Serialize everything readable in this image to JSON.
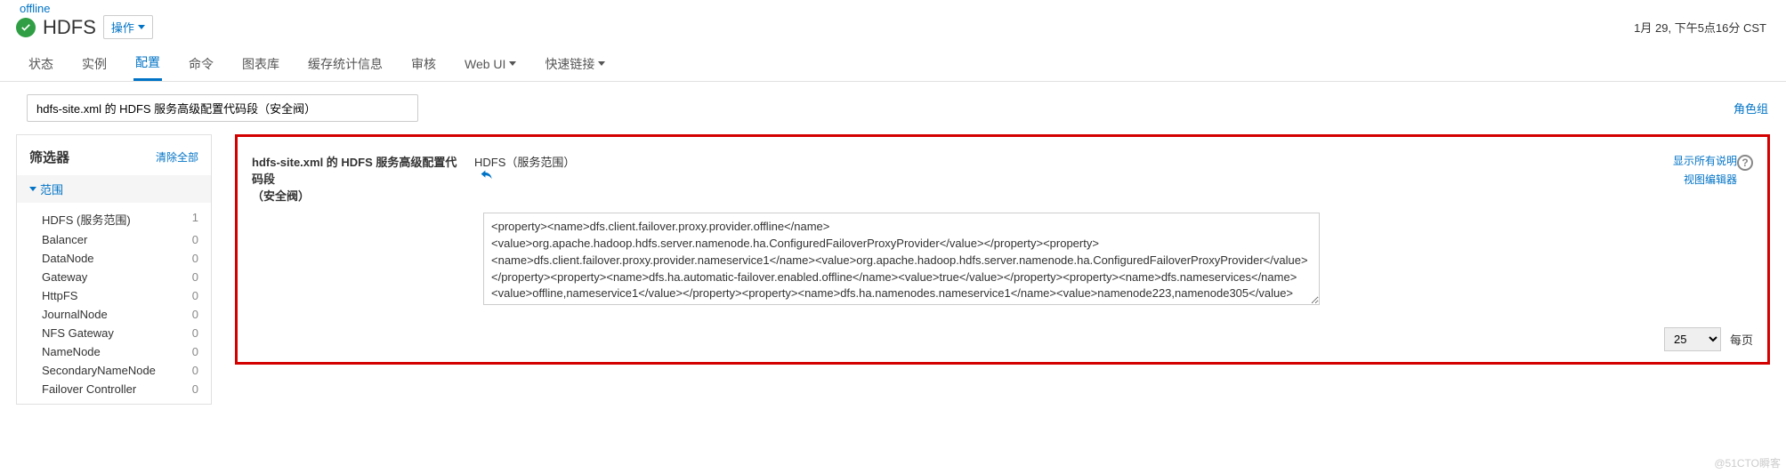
{
  "breadcrumb": {
    "cluster": "offline"
  },
  "header": {
    "title": "HDFS",
    "ops_label": "操作",
    "timestamp": "1月 29, 下午5点16分 CST"
  },
  "tabs": {
    "items": [
      {
        "label": "状态"
      },
      {
        "label": "实例"
      },
      {
        "label": "配置"
      },
      {
        "label": "命令"
      },
      {
        "label": "图表库"
      },
      {
        "label": "缓存统计信息"
      },
      {
        "label": "审核"
      },
      {
        "label": "Web UI"
      },
      {
        "label": "快速链接"
      }
    ]
  },
  "search": {
    "value": "hdfs-site.xml 的 HDFS 服务高级配置代码段（安全阀）",
    "role_group_link": "角色组"
  },
  "filter": {
    "title": "筛选器",
    "clear_all": "清除全部",
    "section_scope": "范围",
    "items": [
      {
        "name": "HDFS (服务范围)",
        "count": "1"
      },
      {
        "name": "Balancer",
        "count": "0"
      },
      {
        "name": "DataNode",
        "count": "0"
      },
      {
        "name": "Gateway",
        "count": "0"
      },
      {
        "name": "HttpFS",
        "count": "0"
      },
      {
        "name": "JournalNode",
        "count": "0"
      },
      {
        "name": "NFS Gateway",
        "count": "0"
      },
      {
        "name": "NameNode",
        "count": "0"
      },
      {
        "name": "SecondaryNameNode",
        "count": "0"
      },
      {
        "name": "Failover Controller",
        "count": "0"
      }
    ]
  },
  "config": {
    "label_line1": "hdfs-site.xml 的 HDFS 服务高级配置代码段",
    "label_line2": "（安全阀）",
    "scope_label": "HDFS（服务范围）",
    "show_desc_link": "显示所有说明",
    "view_editor_link": "视图编辑器",
    "xml_value": "<property><name>dfs.client.failover.proxy.provider.offline</name><value>org.apache.hadoop.hdfs.server.namenode.ha.ConfiguredFailoverProxyProvider</value></property><property><name>dfs.client.failover.proxy.provider.nameservice1</name><value>org.apache.hadoop.hdfs.server.namenode.ha.ConfiguredFailoverProxyProvider</value></property><property><name>dfs.ha.automatic-failover.enabled.offline</name><value>true</value></property><property><name>dfs.nameservices</name><value>offline,nameservice1</value></property><property><name>dfs.ha.namenodes.nameservice1</name><value>namenode223,namenode305</value></property><property><name>dfs.namenode.rpc-"
  },
  "pager": {
    "size": "25",
    "per_page_label": "每页"
  },
  "watermark": "@51CTO瞬客"
}
